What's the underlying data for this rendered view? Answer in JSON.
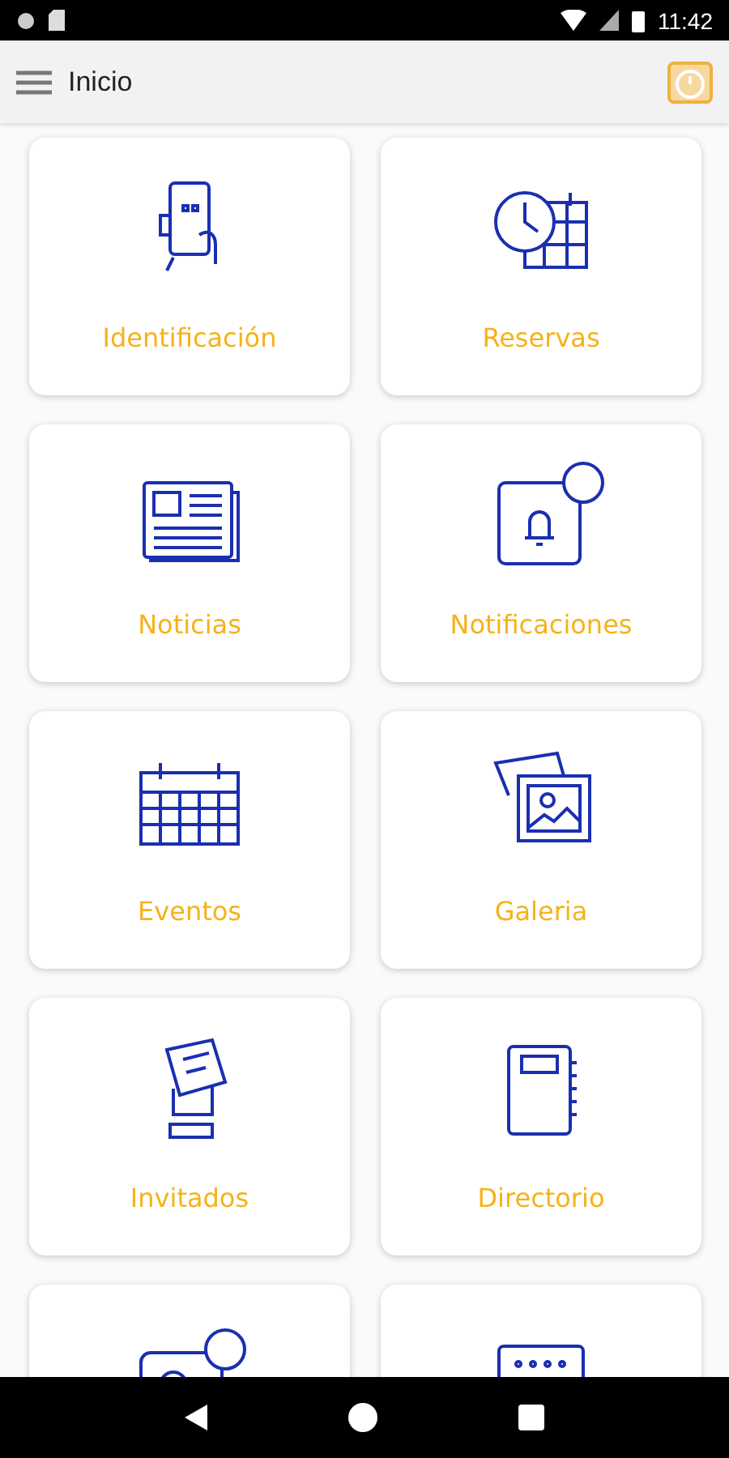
{
  "status_bar": {
    "time": "11:42"
  },
  "app_bar": {
    "title": "Inicio"
  },
  "tiles": [
    {
      "kind": "full",
      "label": "Identificación"
    },
    {
      "kind": "full",
      "label": "Reservas"
    },
    {
      "kind": "full",
      "label": "Noticias"
    },
    {
      "kind": "full",
      "label": "Notificaciones"
    },
    {
      "kind": "full",
      "label": "Eventos"
    },
    {
      "kind": "full",
      "label": "Galeria"
    },
    {
      "kind": "full",
      "label": "Invitados"
    },
    {
      "kind": "full",
      "label": "Directorio"
    },
    {
      "kind": "cut-off"
    },
    {
      "kind": "cut-off"
    }
  ]
}
